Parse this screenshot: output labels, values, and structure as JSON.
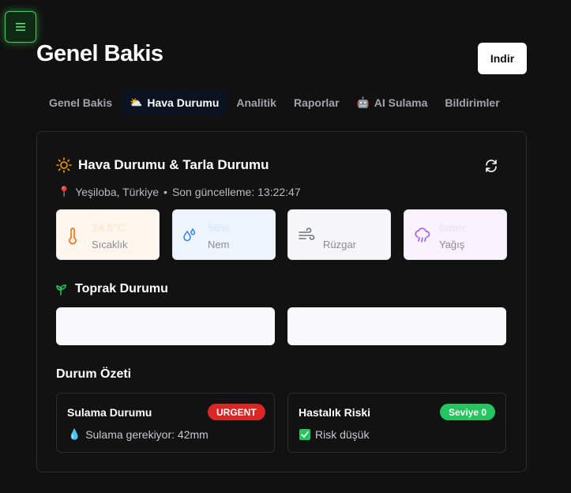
{
  "header": {
    "title": "Genel Bakis",
    "download_label": "Indir"
  },
  "tabs": [
    {
      "label": "Genel Bakis",
      "icon": "",
      "active": false
    },
    {
      "label": "Hava Durumu",
      "icon": "sun-behind-cloud-icon",
      "active": true
    },
    {
      "label": "Analitik",
      "icon": "",
      "active": false
    },
    {
      "label": "Raporlar",
      "icon": "",
      "active": false
    },
    {
      "label": "AI Sulama",
      "icon": "robot-icon",
      "active": false
    },
    {
      "label": "Bildirimler",
      "icon": "",
      "active": false
    }
  ],
  "weather": {
    "title": "Hava Durumu & Tarla Durumu",
    "location": "Yeşiloba, Türkiye",
    "updated": "Son güncelleme: 13:22:47",
    "metrics": {
      "temperature": {
        "value": "24.5°C",
        "label": "Sıcaklık"
      },
      "humidity": {
        "value": "56%",
        "label": "Nem"
      },
      "wind": {
        "value": "",
        "label": "Rüzgar"
      },
      "rain": {
        "value": "0mm",
        "label": "Yağış"
      }
    }
  },
  "soil": {
    "title": "Toprak Durumu"
  },
  "summary": {
    "title": "Durum Özeti",
    "irrigation": {
      "title": "Sulama Durumu",
      "badge": "URGENT",
      "text": "Sulama gerekiyor: 42mm"
    },
    "disease": {
      "title": "Hastalık Riski",
      "badge": "Seviye 0",
      "text": "Risk düşük"
    }
  },
  "colors": {
    "accent_green": "#3ecf5a",
    "urgent_red": "#dc2626",
    "level_green": "#22c55e",
    "sun_orange": "#f59e0b"
  }
}
